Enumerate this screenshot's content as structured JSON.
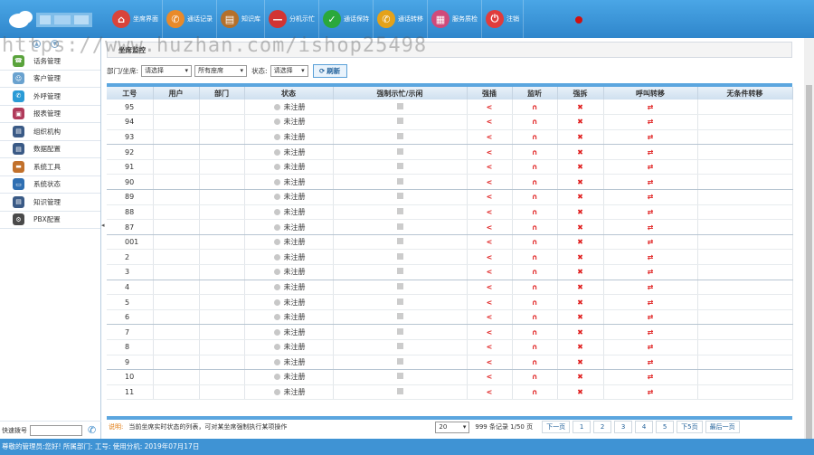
{
  "toolbar": {
    "items": [
      {
        "label": "坐席界面",
        "icon": "seat-icon",
        "color": "#d9443b"
      },
      {
        "label": "通话记录",
        "icon": "phone-record-icon",
        "color": "#e98a2a"
      },
      {
        "label": "知识库",
        "icon": "book-icon",
        "color": "#b4702b"
      },
      {
        "label": "分机示忙",
        "icon": "busy-icon",
        "color": "#d23434"
      },
      {
        "label": "通话保持",
        "icon": "check-icon",
        "color": "#2aa83b"
      },
      {
        "label": "通话转移",
        "icon": "transfer-call-icon",
        "color": "#e4a21a"
      },
      {
        "label": "服务质检",
        "icon": "grid-icon",
        "color": "#d04a7a"
      },
      {
        "label": "注销",
        "icon": "power-icon",
        "color": "#e03c3c"
      }
    ]
  },
  "watermark": "https://www.huzhan.com/ishop25498",
  "sidebar": {
    "items": [
      {
        "label": "话务管理",
        "icon": "headset-icon",
        "color": "#5aa33c"
      },
      {
        "label": "客户管理",
        "icon": "customer-icon",
        "color": "#6aa2cf"
      },
      {
        "label": "外呼管理",
        "icon": "outbound-icon",
        "color": "#2a9bd6"
      },
      {
        "label": "报表管理",
        "icon": "report-icon",
        "color": "#b03a5a"
      },
      {
        "label": "组织机构",
        "icon": "org-icon",
        "color": "#3a5a86"
      },
      {
        "label": "数据配置",
        "icon": "data-config-icon",
        "color": "#3a5a86"
      },
      {
        "label": "系统工具",
        "icon": "toolbox-icon",
        "color": "#c2712c"
      },
      {
        "label": "系统状态",
        "icon": "monitor-icon",
        "color": "#2f6fb2"
      },
      {
        "label": "知识管理",
        "icon": "knowledge-icon",
        "color": "#3a5a86"
      },
      {
        "label": "PBX配置",
        "icon": "gear-icon",
        "color": "#4a4a4a"
      }
    ],
    "quick_dial_label": "快速拨号"
  },
  "panel": {
    "title": "坐席监控"
  },
  "filters": {
    "dept_label": "部门/坐席:",
    "dept_value": "请选择",
    "seat_value": "所有座席",
    "status_label": "状态:",
    "status_value": "请选择",
    "refresh_label": "刷新"
  },
  "table": {
    "headers": [
      "工号",
      "用户",
      "部门",
      "状态",
      "强制示忙/示闲",
      "强插",
      "监听",
      "强拆",
      "呼叫转移",
      "无条件转移"
    ],
    "rows": [
      {
        "id": "95",
        "status": "未注册"
      },
      {
        "id": "94",
        "status": "未注册"
      },
      {
        "id": "93",
        "status": "未注册"
      },
      {
        "id": "92",
        "status": "未注册"
      },
      {
        "id": "91",
        "status": "未注册"
      },
      {
        "id": "90",
        "status": "未注册"
      },
      {
        "id": "89",
        "status": "未注册"
      },
      {
        "id": "88",
        "status": "未注册"
      },
      {
        "id": "87",
        "status": "未注册"
      },
      {
        "id": "001",
        "status": "未注册"
      },
      {
        "id": "2",
        "status": "未注册"
      },
      {
        "id": "3",
        "status": "未注册"
      },
      {
        "id": "4",
        "status": "未注册"
      },
      {
        "id": "5",
        "status": "未注册"
      },
      {
        "id": "6",
        "status": "未注册"
      },
      {
        "id": "7",
        "status": "未注册"
      },
      {
        "id": "8",
        "status": "未注册"
      },
      {
        "id": "9",
        "status": "未注册"
      },
      {
        "id": "10",
        "status": "未注册"
      },
      {
        "id": "11",
        "status": "未注册"
      }
    ]
  },
  "footer": {
    "note_label": "说明:",
    "note_text": "当前坐席实时状态的列表，可对某坐席强制执行某项操作",
    "page_size": "20",
    "record_info": "999 条记录 1/50 页",
    "prev": "下一页",
    "pages": [
      "1",
      "2",
      "3",
      "4",
      "5"
    ],
    "next_five": "下5页",
    "last": "最后一页"
  },
  "status_bar": "尊敬的管理员:您好! 所属部门: 工号: 使用分机: 2019年07月17日"
}
